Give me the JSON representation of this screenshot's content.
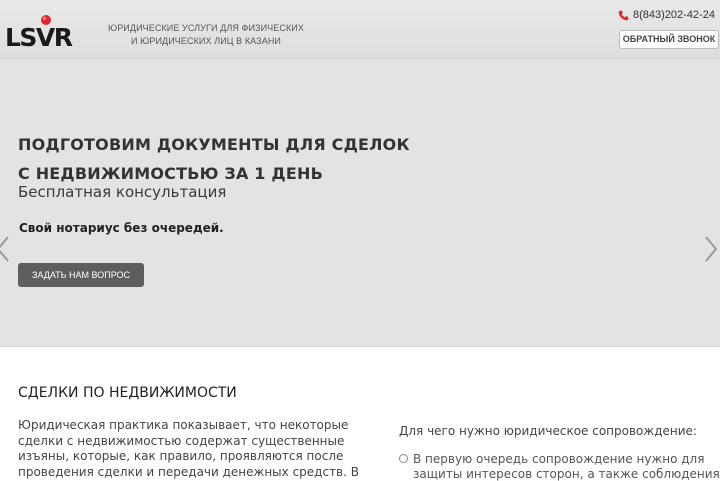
{
  "header": {
    "logo": {
      "text": "LSVR",
      "accent_color": "#e3262e"
    },
    "tagline": [
      "ЮРИДИЧЕСКИЕ УСЛУГИ ДЛЯ ФИЗИЧЕСКИХ",
      "И ЮРИДИЧЕСКИХ ЛИЦ В КАЗАНИ"
    ],
    "phone": {
      "icon": "phone-icon",
      "number": "8(843)202-42-24",
      "icon_color": "#e3262e"
    },
    "callback_label": "ОБРАТНЫЙ ЗВОНОК"
  },
  "hero": {
    "title_lines": [
      "ПОДГОТОВИМ ДОКУМЕНТЫ ДЛЯ СДЕЛОК",
      "С НЕДВИЖИМОСТЬЮ ЗА 1 ДЕНЬ"
    ],
    "subtitle": "Бесплатная консультация",
    "note": "Свой нотариус без очередей.",
    "button_label": "ЗАДАТЬ НАМ ВОПРОС",
    "arrows": [
      "chevron-left-icon",
      "chevron-right-icon"
    ],
    "background_color": "#e3e3e3"
  },
  "content": {
    "title": "СДЕЛКИ ПО НЕДВИЖИМОСТИ",
    "paragraph_lines": [
      "Юридическая практика показывает, что некоторые",
      "сделки с недвижимостью содержат существенные",
      "изъяны, которые, как правило, проявляются после",
      "проведения сделки и передачи денежных средств. В"
    ],
    "side": {
      "title": "Для чего нужно юридическое сопровождение:",
      "item_lines": [
        "В первую очередь сопровождение нужно  для",
        "защиты интересов сторон, а также соблюдения"
      ]
    }
  }
}
